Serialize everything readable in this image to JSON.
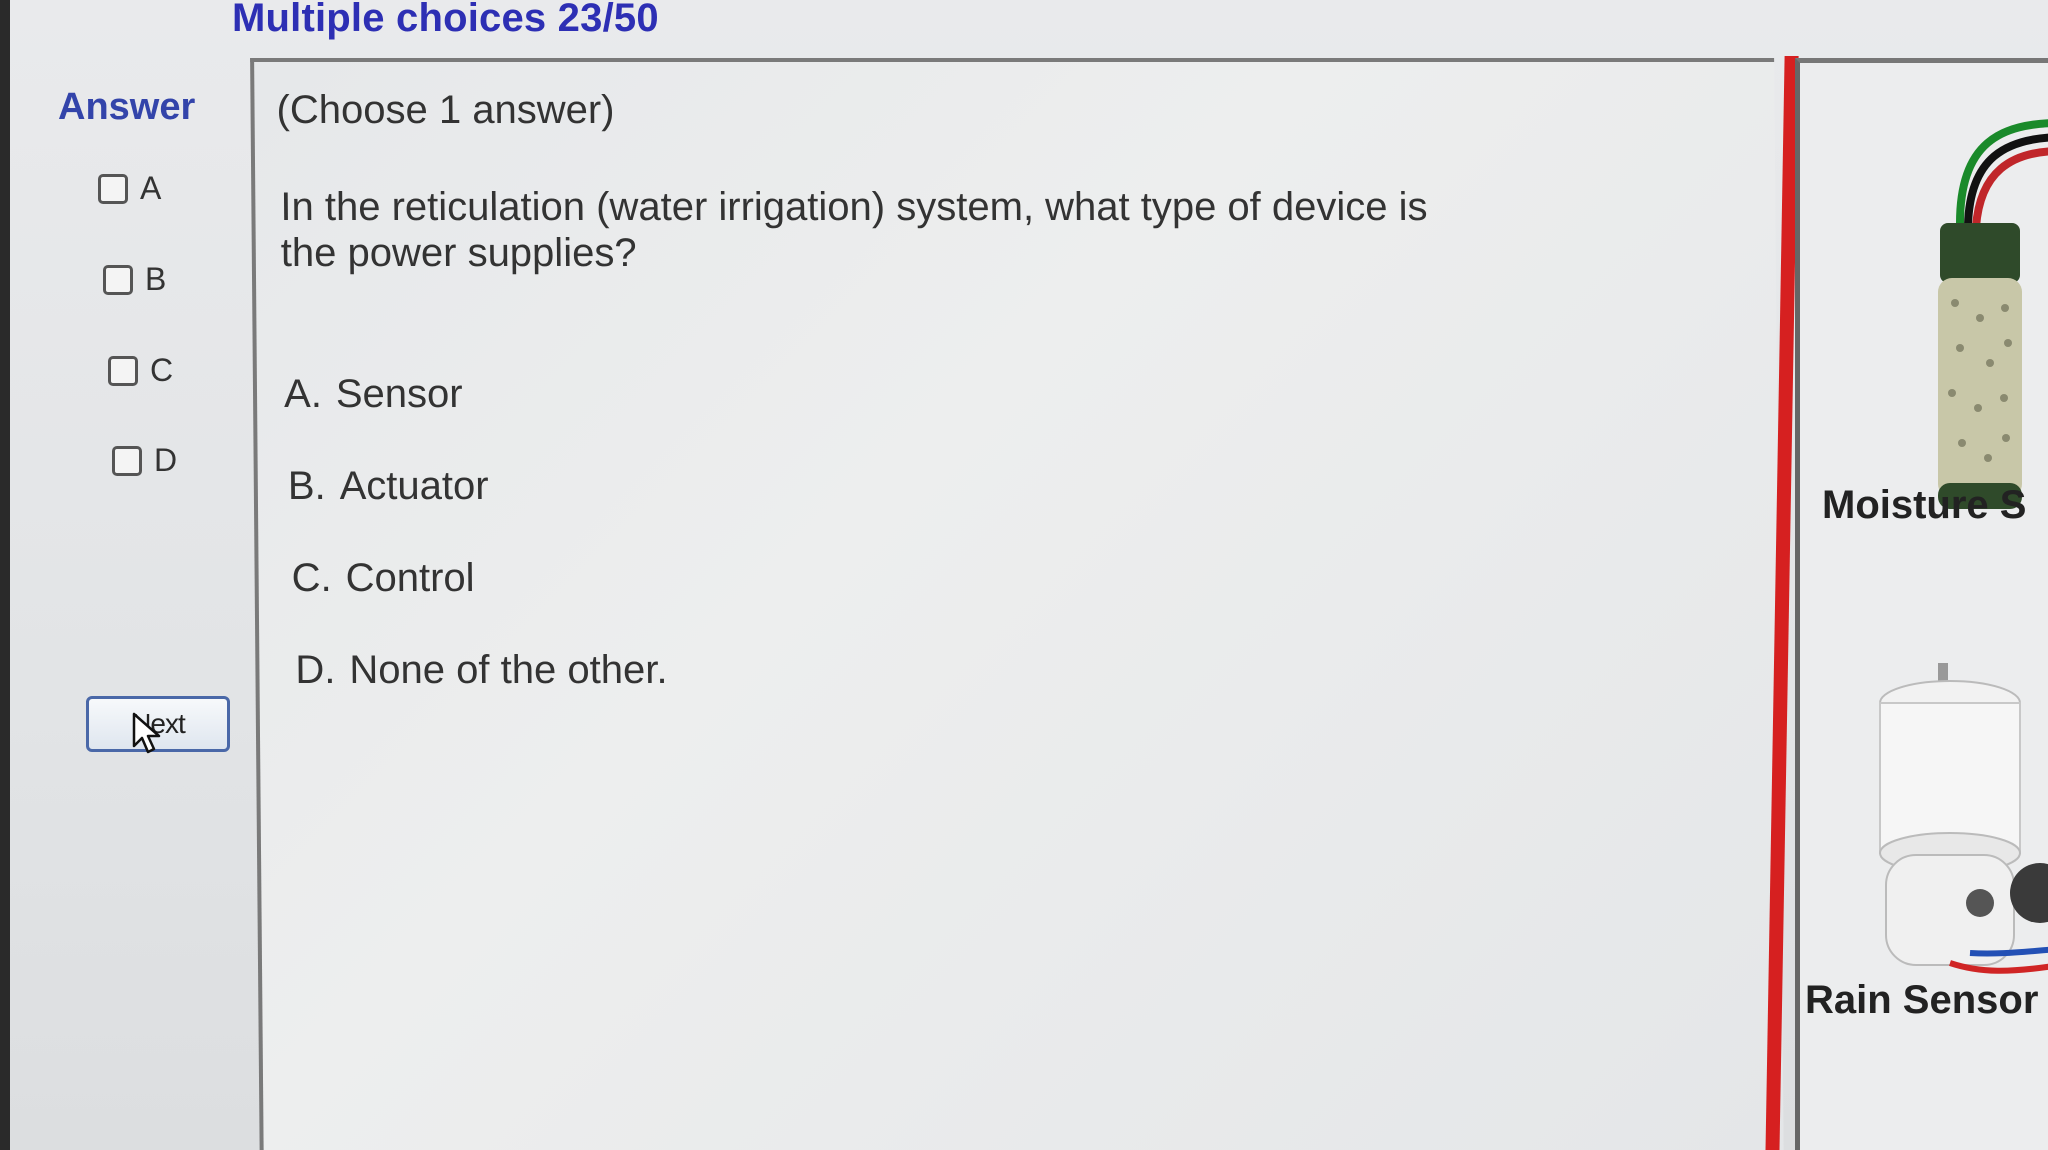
{
  "header": {
    "title": "Multiple choices 23/50"
  },
  "answer_panel": {
    "label": "Answer",
    "choices": [
      {
        "letter": "A",
        "checked": false
      },
      {
        "letter": "B",
        "checked": false
      },
      {
        "letter": "C",
        "checked": false
      },
      {
        "letter": "D",
        "checked": false
      }
    ],
    "next_label": "Next"
  },
  "question": {
    "instruction": "(Choose 1 answer)",
    "text": "In the reticulation  (water irrigation) system, what type of device is the power supplies?",
    "options": [
      {
        "letter": "A.",
        "text": "Sensor"
      },
      {
        "letter": "B.",
        "text": "Actuator"
      },
      {
        "letter": "C.",
        "text": "Control"
      },
      {
        "letter": "D.",
        "text": "None of the other."
      }
    ]
  },
  "illustrations": {
    "moisture_label": "Moisture S",
    "rain_label": "Rain Sensor"
  },
  "colors": {
    "title": "#2d2fb4",
    "answer_label": "#3344aa",
    "divider_red": "#d62020",
    "button_border": "#4a68a8"
  }
}
